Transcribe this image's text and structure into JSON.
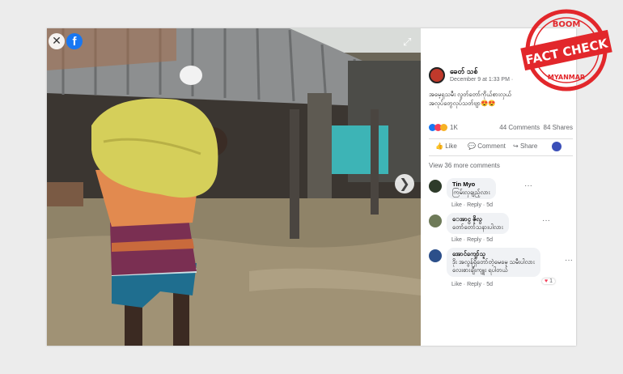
{
  "viewer": {
    "close_label": "✕",
    "fb_letter": "f",
    "expand_glyph": "⤢",
    "next_glyph": "❯"
  },
  "post": {
    "author": "ခေတ် သစ်",
    "date": "December 9 at 1:33 PM · ",
    "text_line1": "အမေ့ရှသမီး လွတ်တော်ကိုယ်စားလှယ်",
    "text_line2": "အလုပ်တွေလုပ်သတ်ဗျာ😍😍",
    "reaction_count": "1K",
    "comments_count": "44 Comments",
    "shares_count": "84 Shares"
  },
  "actions": {
    "like": "Like",
    "comment": "Comment",
    "share": "Share"
  },
  "view_more": "View 36 more comments",
  "comments": [
    {
      "name": "Tin Myo",
      "text": "ကြမ်းလှချည့်လား",
      "like": "Like",
      "reply": "Reply",
      "time": "5d"
    },
    {
      "name": "ေအာင္ ဇိုလ္",
      "text": "တော်တော်သနားပါလား",
      "like": "Like",
      "reply": "Reply",
      "time": "5d"
    },
    {
      "name": "အောင်ကျော်သူ",
      "text": "ဒိုး အလွန်ရှိတော်တဲ့မေမေ့ သမီးပါလား",
      "text2": "လေးစားချီးကျူး ရပါတယ်",
      "like": "Like",
      "reply": "Reply",
      "time": "5d",
      "reacts": "1"
    }
  ],
  "stamp": {
    "top": "BOOM",
    "middle": "FACT CHECK",
    "bottom": "MYANMAR"
  },
  "colors": {
    "stamp_red": "#e2272b",
    "fb_blue": "#1877f2"
  }
}
